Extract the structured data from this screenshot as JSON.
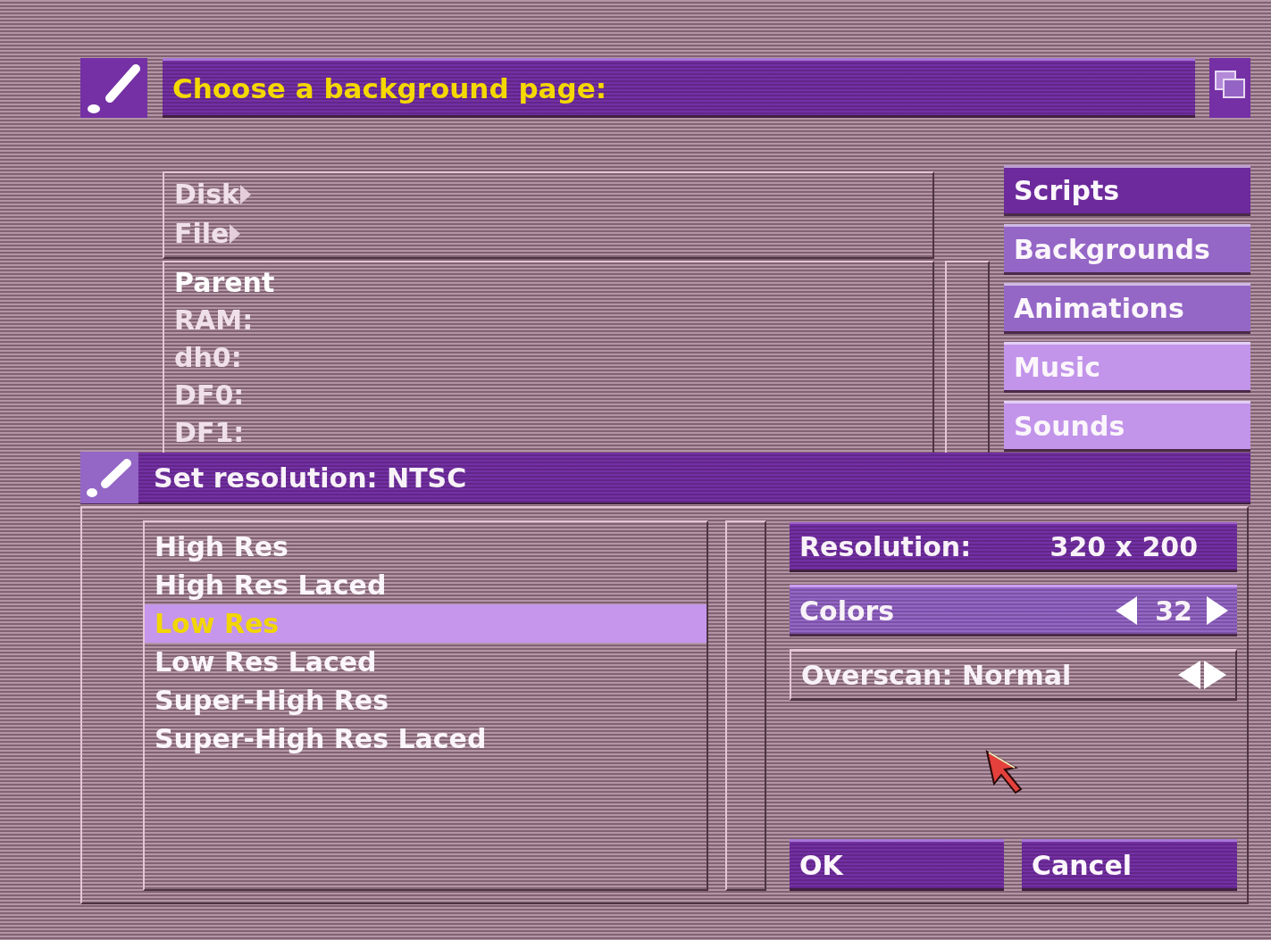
{
  "back_window": {
    "title": "Choose a background page:",
    "menus": [
      {
        "label": "Disk",
        "disabled": true
      },
      {
        "label": "File",
        "disabled": true
      }
    ],
    "volumes": [
      {
        "label": "Parent",
        "disabled": false
      },
      {
        "label": "RAM:",
        "disabled": true
      },
      {
        "label": "dh0:",
        "disabled": true
      },
      {
        "label": "DF0:",
        "disabled": true
      },
      {
        "label": "DF1:",
        "disabled": true
      }
    ],
    "categories": [
      {
        "label": "Scripts",
        "color": "#6c2a9c"
      },
      {
        "label": "Backgrounds",
        "color": "#9466c6"
      },
      {
        "label": "Animations",
        "color": "#9466c6"
      },
      {
        "label": "Music",
        "color": "#c294ea"
      },
      {
        "label": "Sounds",
        "color": "#c294ea"
      }
    ]
  },
  "resolution_window": {
    "title": "Set resolution: NTSC",
    "modes": [
      {
        "label": "High Res",
        "selected": false
      },
      {
        "label": "High Res Laced",
        "selected": false
      },
      {
        "label": "Low Res",
        "selected": true
      },
      {
        "label": "Low Res Laced",
        "selected": false
      },
      {
        "label": "Super-High Res",
        "selected": false
      },
      {
        "label": "Super-High Res Laced",
        "selected": false
      }
    ],
    "resolution": {
      "label": "Resolution:",
      "value": "320 x 200"
    },
    "colors": {
      "label": "Colors",
      "value": "32"
    },
    "overscan": {
      "label": "Overscan: Normal"
    },
    "buttons": [
      "OK",
      "Cancel"
    ]
  }
}
